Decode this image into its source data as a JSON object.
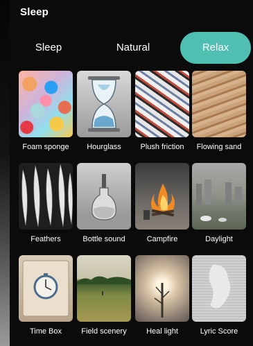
{
  "header": {
    "title": "Sleep"
  },
  "tabs": [
    {
      "label": "Sleep",
      "active": false
    },
    {
      "label": "Natural",
      "active": false
    },
    {
      "label": "Relax",
      "active": true
    }
  ],
  "colors": {
    "accent": "#4fbfb1",
    "background": "#0b0b0b"
  },
  "items": [
    {
      "label": "Foam sponge",
      "icon": "foam-sponge-thumbnail"
    },
    {
      "label": "Hourglass",
      "icon": "hourglass-thumbnail"
    },
    {
      "label": "Plush friction",
      "icon": "plush-friction-thumbnail"
    },
    {
      "label": "Flowing sand",
      "icon": "flowing-sand-thumbnail"
    },
    {
      "label": "Feathers",
      "icon": "feathers-thumbnail"
    },
    {
      "label": "Bottle sound",
      "icon": "bottle-sound-thumbnail"
    },
    {
      "label": "Campfire",
      "icon": "campfire-thumbnail"
    },
    {
      "label": "Daylight",
      "icon": "daylight-thumbnail"
    },
    {
      "label": "Time Box",
      "icon": "time-box-thumbnail"
    },
    {
      "label": "Field scenery",
      "icon": "field-scenery-thumbnail"
    },
    {
      "label": "Heal light",
      "icon": "heal-light-thumbnail"
    },
    {
      "label": "Lyric Score",
      "icon": "lyric-score-thumbnail"
    }
  ]
}
